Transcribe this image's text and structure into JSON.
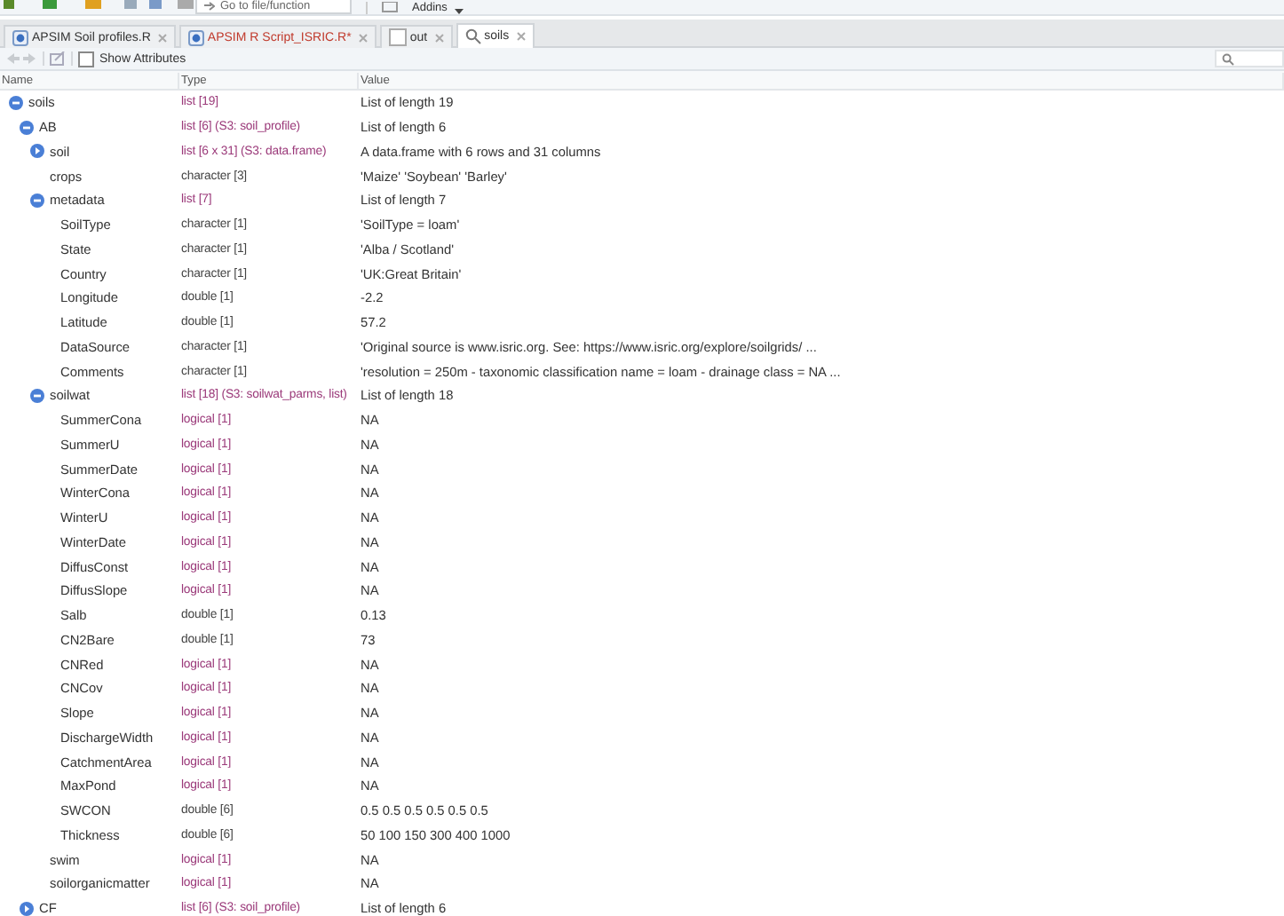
{
  "toolbar": {
    "goto_placeholder": "Go to file/function",
    "addins": "Addins"
  },
  "tabs": [
    {
      "label": "APSIM Soil profiles.R",
      "kind": "script",
      "modified": false,
      "selected": false
    },
    {
      "label": "APSIM R Script_ISRIC.R*",
      "kind": "script",
      "modified": true,
      "selected": false
    },
    {
      "label": "out",
      "kind": "data",
      "modified": false,
      "selected": false
    },
    {
      "label": "soils",
      "kind": "viewer",
      "modified": false,
      "selected": true
    }
  ],
  "viewer_toolbar": {
    "show_attributes": {
      "label": "Show Attributes",
      "checked": false
    }
  },
  "columns": [
    "Name",
    "Type",
    "Value"
  ],
  "tree": [
    {
      "name": "soils",
      "type": "list [19]",
      "kind": "list",
      "value": "List of length 19",
      "expanded": true,
      "children": [
        {
          "name": "AB",
          "type": "list [6] (S3: soil_profile)",
          "kind": "list",
          "value": "List of length 6",
          "expanded": true,
          "children": [
            {
              "name": "soil",
              "type": "list [6 x 31] (S3: data.frame)",
              "kind": "list",
              "value": "A data.frame with 6 rows and 31 columns",
              "expanded": false
            },
            {
              "name": "crops",
              "type": "character [3]",
              "kind": "character",
              "value": "'Maize' 'Soybean' 'Barley'"
            },
            {
              "name": "metadata",
              "type": "list [7]",
              "kind": "list",
              "value": "List of length 7",
              "expanded": true,
              "children": [
                {
                  "name": "SoilType",
                  "type": "character [1]",
                  "kind": "character",
                  "value": "'SoilType = loam'"
                },
                {
                  "name": "State",
                  "type": "character [1]",
                  "kind": "character",
                  "value": "'Alba / Scotland'"
                },
                {
                  "name": "Country",
                  "type": "character [1]",
                  "kind": "character",
                  "value": "'UK:Great Britain'"
                },
                {
                  "name": "Longitude",
                  "type": "double [1]",
                  "kind": "double",
                  "value": "-2.2"
                },
                {
                  "name": "Latitude",
                  "type": "double [1]",
                  "kind": "double",
                  "value": "57.2"
                },
                {
                  "name": "DataSource",
                  "type": "character [1]",
                  "kind": "character",
                  "value": "'Original source is www.isric.org. See: https://www.isric.org/explore/soilgrids/ ..."
                },
                {
                  "name": "Comments",
                  "type": "character [1]",
                  "kind": "character",
                  "value": "'resolution = 250m - taxonomic classification name = loam - drainage class = NA ..."
                }
              ]
            },
            {
              "name": "soilwat",
              "type": "list [18] (S3: soilwat_parms, list)",
              "kind": "list",
              "value": "List of length 18",
              "expanded": true,
              "children": [
                {
                  "name": "SummerCona",
                  "type": "logical [1]",
                  "kind": "logical",
                  "value": "NA"
                },
                {
                  "name": "SummerU",
                  "type": "logical [1]",
                  "kind": "logical",
                  "value": "NA"
                },
                {
                  "name": "SummerDate",
                  "type": "logical [1]",
                  "kind": "logical",
                  "value": "NA"
                },
                {
                  "name": "WinterCona",
                  "type": "logical [1]",
                  "kind": "logical",
                  "value": "NA"
                },
                {
                  "name": "WinterU",
                  "type": "logical [1]",
                  "kind": "logical",
                  "value": "NA"
                },
                {
                  "name": "WinterDate",
                  "type": "logical [1]",
                  "kind": "logical",
                  "value": "NA"
                },
                {
                  "name": "DiffusConst",
                  "type": "logical [1]",
                  "kind": "logical",
                  "value": "NA"
                },
                {
                  "name": "DiffusSlope",
                  "type": "logical [1]",
                  "kind": "logical",
                  "value": "NA"
                },
                {
                  "name": "Salb",
                  "type": "double [1]",
                  "kind": "double",
                  "value": "0.13"
                },
                {
                  "name": "CN2Bare",
                  "type": "double [1]",
                  "kind": "double",
                  "value": "73"
                },
                {
                  "name": "CNRed",
                  "type": "logical [1]",
                  "kind": "logical",
                  "value": "NA"
                },
                {
                  "name": "CNCov",
                  "type": "logical [1]",
                  "kind": "logical",
                  "value": "NA"
                },
                {
                  "name": "Slope",
                  "type": "logical [1]",
                  "kind": "logical",
                  "value": "NA"
                },
                {
                  "name": "DischargeWidth",
                  "type": "logical [1]",
                  "kind": "logical",
                  "value": "NA"
                },
                {
                  "name": "CatchmentArea",
                  "type": "logical [1]",
                  "kind": "logical",
                  "value": "NA"
                },
                {
                  "name": "MaxPond",
                  "type": "logical [1]",
                  "kind": "logical",
                  "value": "NA"
                },
                {
                  "name": "SWCON",
                  "type": "double [6]",
                  "kind": "double",
                  "value": "0.5 0.5 0.5 0.5 0.5 0.5"
                },
                {
                  "name": "Thickness",
                  "type": "double [6]",
                  "kind": "double",
                  "value": "50 100 150 300 400 1000"
                }
              ]
            },
            {
              "name": "swim",
              "type": "logical [1]",
              "kind": "logical",
              "value": "NA"
            },
            {
              "name": "soilorganicmatter",
              "type": "logical [1]",
              "kind": "logical",
              "value": "NA"
            }
          ]
        },
        {
          "name": "CF",
          "type": "list [6] (S3: soil_profile)",
          "kind": "list",
          "value": "List of length 6",
          "expanded": false
        }
      ]
    }
  ]
}
